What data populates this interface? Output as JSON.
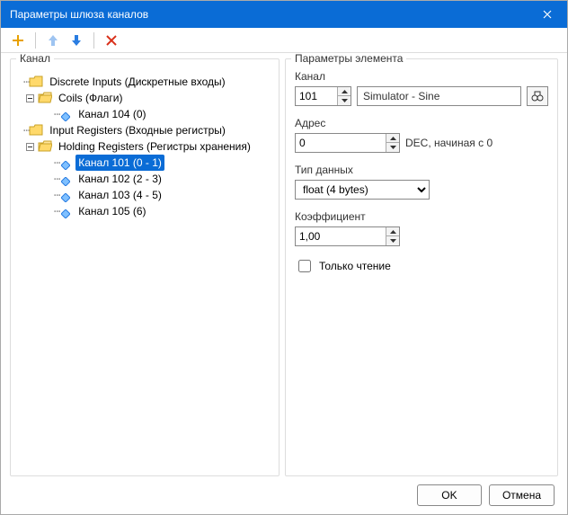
{
  "window": {
    "title": "Параметры шлюза каналов"
  },
  "panels": {
    "left": "Канал",
    "right": "Параметры элемента"
  },
  "toolbar": {
    "add": "add",
    "up": "up",
    "down": "down",
    "delete": "delete"
  },
  "tree": {
    "items": [
      {
        "label": "Discrete Inputs (Дискретные входы)"
      },
      {
        "label": "Coils (Флаги)"
      },
      {
        "label": "Канал 104 (0)"
      },
      {
        "label": "Input Registers (Входные регистры)"
      },
      {
        "label": "Holding Registers (Регистры хранения)"
      },
      {
        "label": "Канал 101 (0 - 1)"
      },
      {
        "label": "Канал 102 (2 - 3)"
      },
      {
        "label": "Канал 103 (4 - 5)"
      },
      {
        "label": "Канал 105 (6)"
      }
    ]
  },
  "form": {
    "channel_label": "Канал",
    "channel_value": "101",
    "channel_name": "Simulator - Sine",
    "address_label": "Адрес",
    "address_value": "0",
    "address_suffix": "DEC, начиная с 0",
    "datatype_label": "Тип данных",
    "datatype_value": "float (4 bytes)",
    "coef_label": "Коэффициент",
    "coef_value": "1,00",
    "readonly_label": "Только чтение"
  },
  "footer": {
    "ok": "OK",
    "cancel": "Отмена"
  }
}
